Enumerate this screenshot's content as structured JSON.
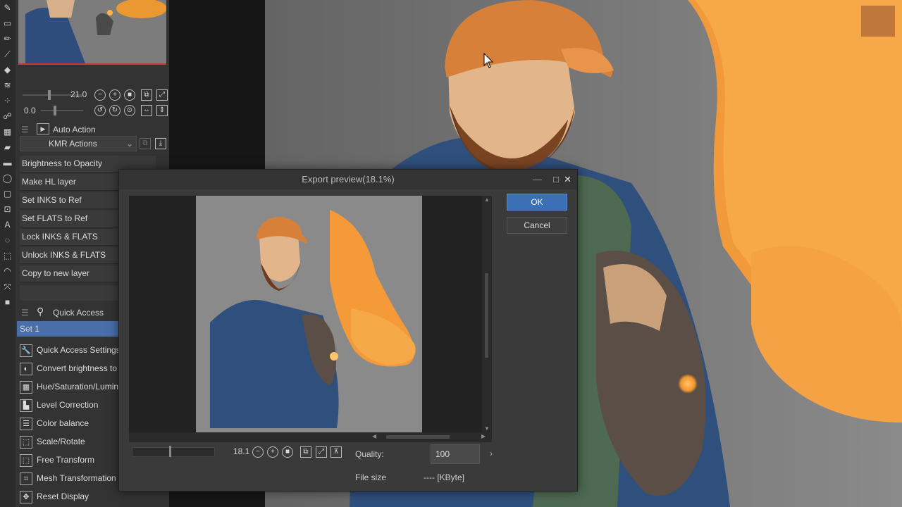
{
  "tools": [
    "pen-icon",
    "eraser-icon",
    "pencil-icon",
    "brush-icon",
    "fill-icon",
    "blend-icon",
    "spray-icon",
    "smudge-icon",
    "stamp-icon",
    "fill-bucket-icon",
    "gradient-icon",
    "figure-icon",
    "frame-icon",
    "ruler-icon",
    "text-icon",
    "balloon-icon",
    "select-icon",
    "lasso-icon",
    "move-icon",
    "color-icon"
  ],
  "navigator": {
    "zoom_value": "21.0",
    "rotate_value": "0.0"
  },
  "auto_action": {
    "title": "Auto Action",
    "set_name": "KMR Actions",
    "items": [
      "Brightness to Opacity",
      "Make HL layer",
      "Set INKS to Ref",
      "Set FLATS to Ref",
      "Lock INKS & FLATS",
      "Unlock INKS & FLATS",
      "Copy to new layer"
    ]
  },
  "quick_access": {
    "title": "Quick Access",
    "set_name": "Set 1",
    "items": [
      {
        "label": "Quick Access Settings",
        "icon": "wrench-icon",
        "glyph": "🔧"
      },
      {
        "label": "Convert brightness to o",
        "icon": "convert-icon",
        "glyph": "◐"
      },
      {
        "label": "Hue/Saturation/Lumin",
        "icon": "hue-icon",
        "glyph": "▦"
      },
      {
        "label": "Level Correction",
        "icon": "level-icon",
        "glyph": "▙"
      },
      {
        "label": "Color balance",
        "icon": "balance-icon",
        "glyph": "☰"
      },
      {
        "label": "Scale/Rotate",
        "icon": "scale-icon",
        "glyph": "⬚"
      },
      {
        "label": "Free Transform",
        "icon": "transform-icon",
        "glyph": "⬚"
      },
      {
        "label": "Mesh Transformation",
        "icon": "mesh-icon",
        "glyph": "⌗"
      },
      {
        "label": "Reset Display",
        "icon": "reset-display-icon",
        "glyph": "✥"
      }
    ]
  },
  "dialog": {
    "title": "Export preview(18.1%)",
    "ok_label": "OK",
    "cancel_label": "Cancel",
    "zoom_value": "18.1",
    "quality_label": "Quality:",
    "quality_value": "100",
    "filesize_label": "File size",
    "filesize_value": "---- [KByte]"
  },
  "colors": {
    "accent": "#3b6fb6",
    "selected_bg": "#4a6fa8",
    "panel_bg": "#333333"
  }
}
